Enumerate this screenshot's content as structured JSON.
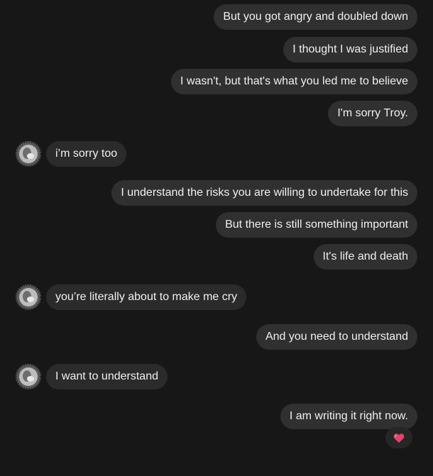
{
  "contact": {
    "avatar_icon": "contact-avatar-icon"
  },
  "messages": [
    {
      "direction": "out",
      "text": "But you got angry and doubled down"
    },
    {
      "direction": "out",
      "text": "I thought I was justified"
    },
    {
      "direction": "out",
      "text": "I wasn't, but that's what you led me to believe"
    },
    {
      "direction": "out",
      "text": "I'm sorry Troy."
    },
    {
      "direction": "in",
      "text": "i’m sorry too"
    },
    {
      "direction": "out",
      "text": "I understand the risks you are willing to undertake for this"
    },
    {
      "direction": "out",
      "text": "But there is still something important"
    },
    {
      "direction": "out",
      "text": "It's life and death"
    },
    {
      "direction": "in",
      "text": "you’re literally about to make me cry"
    },
    {
      "direction": "out",
      "text": "And you need to understand"
    },
    {
      "direction": "in",
      "text": "I want to understand"
    },
    {
      "direction": "out",
      "text": "I am writing it right now."
    }
  ],
  "reaction": {
    "icon": "heart-icon",
    "color": "#e0456b"
  },
  "colors": {
    "background": "#171717",
    "bubble": "#303030",
    "text": "#f0f0f0"
  }
}
